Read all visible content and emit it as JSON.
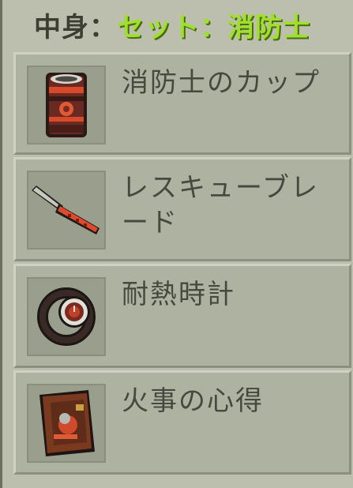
{
  "header": {
    "contents_label": "中身：",
    "set_name": "セット：消防士"
  },
  "items": [
    {
      "name": "消防士のカップ",
      "icon": "firefighter-cup-icon"
    },
    {
      "name": "レスキューブレード",
      "icon": "rescue-blade-icon"
    },
    {
      "name": "耐熱時計",
      "icon": "heatproof-watch-icon"
    },
    {
      "name": "火事の心得",
      "icon": "fire-guide-book-icon"
    }
  ],
  "colors": {
    "panel_bg": "#bcbfae",
    "item_bg": "#aeb2a0",
    "icon_bg": "#9a9e8c",
    "set_name": "#9fe02a",
    "text": "#47483f"
  }
}
